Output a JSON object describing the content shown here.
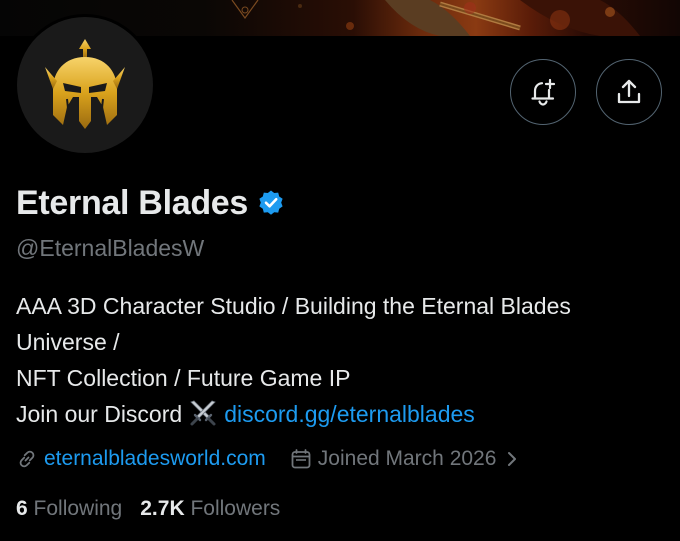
{
  "profile": {
    "display_name": "Eternal Blades",
    "handle": "@EternalBladesW",
    "bio_lines": [
      "AAA 3D Character Studio / Building the Eternal Blades",
      "Universe /",
      "NFT Collection / Future Game IP"
    ],
    "bio_join_text": "Join our Discord",
    "bio_link": "discord.gg/eternalblades",
    "website": "eternalbladesworld.com",
    "joined": "Joined March 2026",
    "following_count": "6",
    "following_label": "Following",
    "followers_count": "2.7K",
    "followers_label": "Followers"
  },
  "icons": {
    "verified": "verified-badge-icon",
    "notify": "bell-plus-icon",
    "share": "share-upload-icon",
    "link": "link-icon",
    "calendar": "calendar-icon",
    "chevron": "chevron-right-icon",
    "swords": "crossed-swords-emoji"
  },
  "colors": {
    "background": "#000000",
    "text_primary": "#e7e9ea",
    "text_secondary": "#71767b",
    "accent": "#1d9bf0",
    "avatar_gold": "#d4a017"
  }
}
